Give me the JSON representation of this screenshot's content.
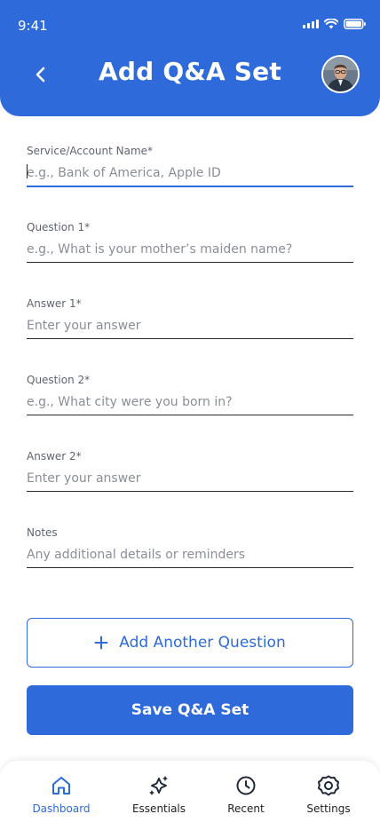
{
  "status_bar": {
    "time": "9:41"
  },
  "header": {
    "title": "Add Q&A Set"
  },
  "form": {
    "fields": [
      {
        "label": "Service/Account Name*",
        "placeholder": "e.g., Bank of America, Apple ID",
        "value": ""
      },
      {
        "label": "Question 1*",
        "placeholder": "e.g., What is your mother’s maiden name?",
        "value": ""
      },
      {
        "label": "Answer 1*",
        "placeholder": "Enter your answer",
        "value": ""
      },
      {
        "label": "Question 2*",
        "placeholder": "e.g., What city were you born in?",
        "value": ""
      },
      {
        "label": "Answer 2*",
        "placeholder": "Enter your answer",
        "value": ""
      },
      {
        "label": "Notes",
        "placeholder": "Any additional details or reminders",
        "value": ""
      }
    ],
    "add_question_label": "Add Another Question",
    "save_label": "Save Q&A Set"
  },
  "tabbar": {
    "tabs": [
      {
        "label": "Dashboard",
        "icon": "home-icon",
        "active": true
      },
      {
        "label": "Essentials",
        "icon": "sparkle-icon",
        "active": false
      },
      {
        "label": "Recent",
        "icon": "clock-icon",
        "active": false
      },
      {
        "label": "Settings",
        "icon": "gear-icon",
        "active": false
      }
    ]
  },
  "colors": {
    "primary": "#2e6ad9",
    "text": "#222222",
    "muted": "#8a8e96"
  }
}
